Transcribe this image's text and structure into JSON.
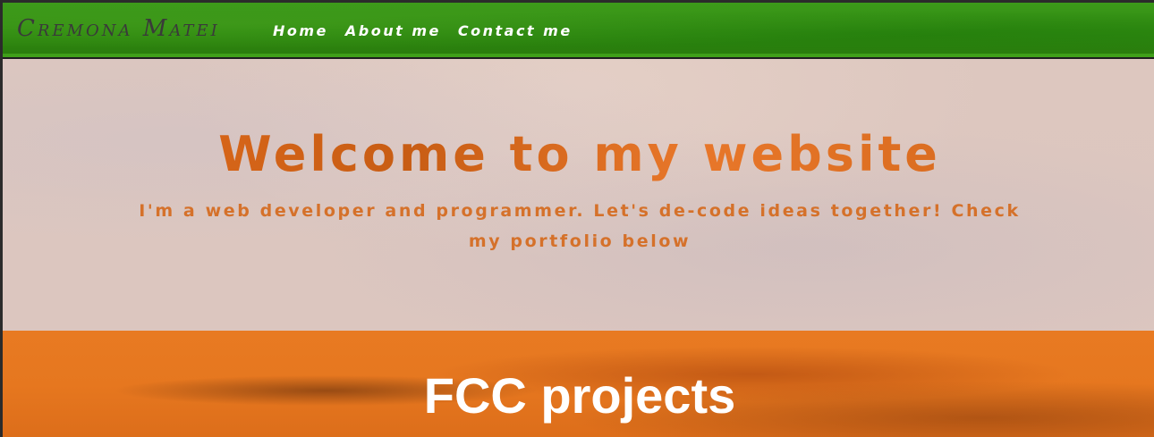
{
  "nav": {
    "brand": "Cremona Matei",
    "links": [
      "Home",
      "About me",
      "Contact me"
    ]
  },
  "hero": {
    "title": "Welcome to my website",
    "subtitle": "I'm a web developer and programmer. Let's de-code ideas together! Check my portfolio below"
  },
  "projects": {
    "title": "FCC projects"
  },
  "colors": {
    "nav_green": "#2f8a10",
    "hero_bg": "#dcc6bf",
    "accent_orange": "#d5712a",
    "projects_orange": "#e6771f"
  }
}
